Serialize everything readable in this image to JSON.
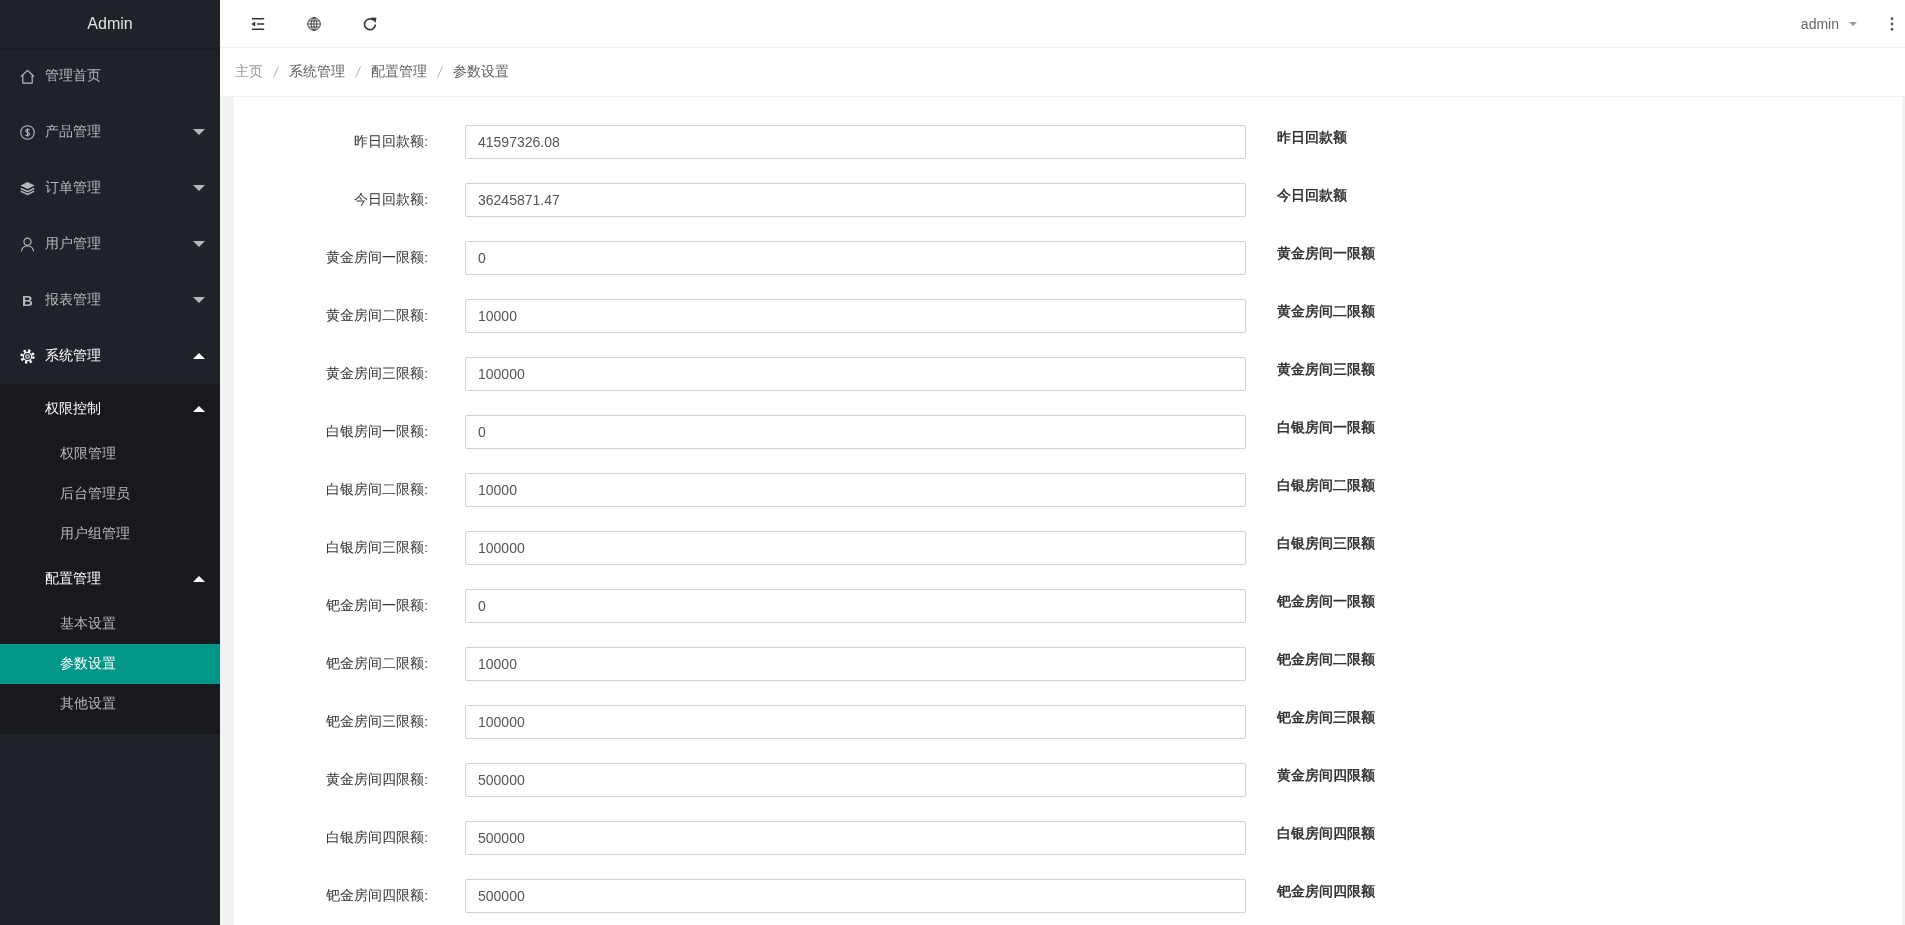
{
  "sidebar": {
    "title": "Admin",
    "items": [
      {
        "kind": "link",
        "label": "管理首页",
        "selected": false
      },
      {
        "kind": "group",
        "label": "产品管理",
        "expanded": false
      },
      {
        "kind": "group",
        "label": "订单管理",
        "expanded": false
      },
      {
        "kind": "group",
        "label": "用户管理",
        "expanded": false
      },
      {
        "kind": "group",
        "icon_text": "B",
        "label": "报表管理",
        "expanded": false
      },
      {
        "kind": "group",
        "label": "系统管理",
        "expanded": true,
        "children": [
          {
            "kind": "group",
            "label": "权限控制",
            "expanded": true,
            "children": [
              {
                "kind": "link",
                "label": "权限管理",
                "selected": false
              },
              {
                "kind": "link",
                "label": "后台管理员",
                "selected": false
              },
              {
                "kind": "link",
                "label": "用户组管理",
                "selected": false
              }
            ]
          },
          {
            "kind": "group",
            "label": "配置管理",
            "expanded": true,
            "children": [
              {
                "kind": "link",
                "label": "基本设置",
                "selected": false
              },
              {
                "kind": "link",
                "label": "参数设置",
                "selected": true
              },
              {
                "kind": "link",
                "label": "其他设置",
                "selected": false
              }
            ]
          }
        ]
      }
    ]
  },
  "topbar": {
    "user": {
      "name": "admin"
    }
  },
  "breadcrumb": [
    {
      "kind": "link",
      "label": "主页"
    },
    {
      "kind": "text",
      "label": "系统管理"
    },
    {
      "kind": "text",
      "label": "配置管理"
    },
    {
      "kind": "text",
      "label": "参数设置"
    }
  ],
  "form": {
    "fields": [
      {
        "label": "昨日回款额:",
        "value": "41597326.08",
        "hint": "昨日回款额"
      },
      {
        "label": "今日回款额:",
        "value": "36245871.47",
        "hint": "今日回款额"
      },
      {
        "label": "黄金房间一限额:",
        "value": "0",
        "hint": "黄金房间一限额"
      },
      {
        "label": "黄金房间二限额:",
        "value": "10000",
        "hint": "黄金房间二限额"
      },
      {
        "label": "黄金房间三限额:",
        "value": "100000",
        "hint": "黄金房间三限额"
      },
      {
        "label": "白银房间一限额:",
        "value": "0",
        "hint": "白银房间一限额"
      },
      {
        "label": "白银房间二限额:",
        "value": "10000",
        "hint": "白银房间二限额"
      },
      {
        "label": "白银房间三限额:",
        "value": "100000",
        "hint": "白银房间三限额"
      },
      {
        "label": "钯金房间一限额:",
        "value": "0",
        "hint": "钯金房间一限额"
      },
      {
        "label": "钯金房间二限额:",
        "value": "10000",
        "hint": "钯金房间二限额"
      },
      {
        "label": "钯金房间三限额:",
        "value": "100000",
        "hint": "钯金房间三限额"
      },
      {
        "label": "黄金房间四限额:",
        "value": "500000",
        "hint": "黄金房间四限额"
      },
      {
        "label": "白银房间四限额:",
        "value": "500000",
        "hint": "白银房间四限额"
      },
      {
        "label": "钯金房间四限额:",
        "value": "500000",
        "hint": "钯金房间四限额"
      }
    ]
  }
}
